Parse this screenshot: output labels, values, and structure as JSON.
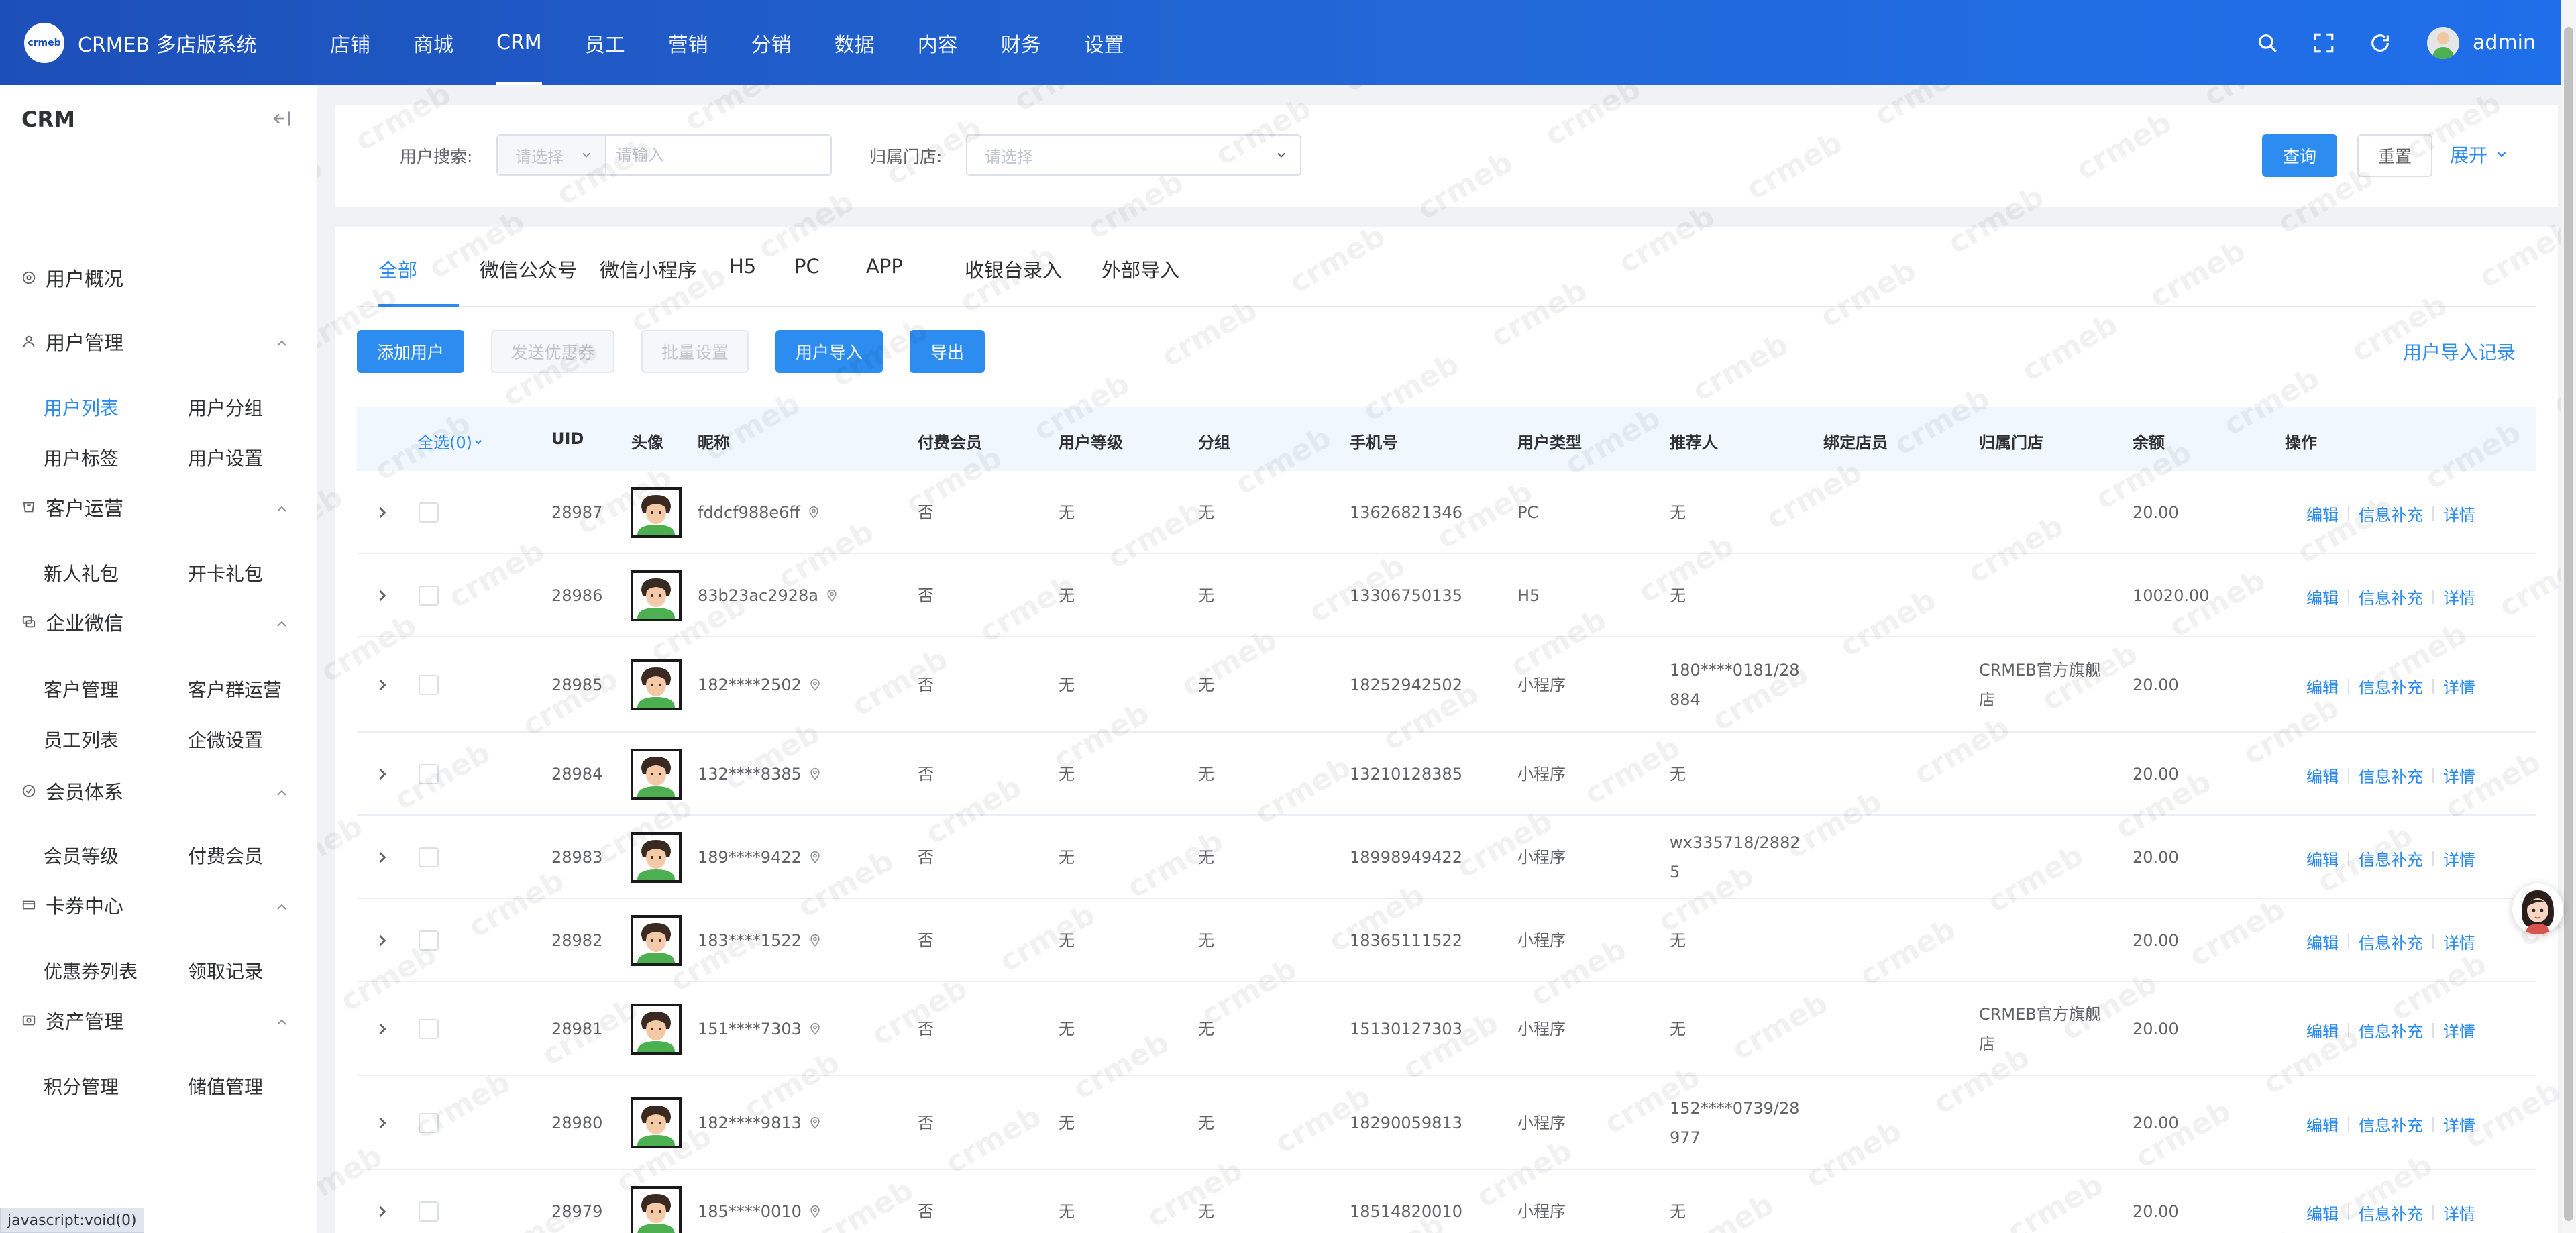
{
  "header": {
    "logo_text": "CRMEB 多店版系统",
    "logo_mark": "crmeb",
    "nav": [
      "店铺",
      "商城",
      "CRM",
      "员工",
      "营销",
      "分销",
      "数据",
      "内容",
      "财务",
      "设置"
    ],
    "active_nav": "CRM",
    "user_name": "admin",
    "icons": [
      "search-icon",
      "fullscreen-icon",
      "refresh-icon"
    ]
  },
  "sidebar": {
    "title": "CRM",
    "groups": [
      {
        "label": "用户概况",
        "icon": "overview-icon",
        "items": []
      },
      {
        "label": "用户管理",
        "icon": "user-icon",
        "items": [
          "用户列表",
          "用户分组",
          "用户标签",
          "用户设置"
        ]
      },
      {
        "label": "客户运营",
        "icon": "operation-icon",
        "items": [
          "新人礼包",
          "开卡礼包"
        ]
      },
      {
        "label": "企业微信",
        "icon": "wechat-work-icon",
        "items": [
          "客户管理",
          "客户群运营",
          "员工列表",
          "企微设置"
        ]
      },
      {
        "label": "会员体系",
        "icon": "member-icon",
        "items": [
          "会员等级",
          "付费会员"
        ]
      },
      {
        "label": "卡券中心",
        "icon": "coupon-icon",
        "items": [
          "优惠券列表",
          "领取记录"
        ]
      },
      {
        "label": "资产管理",
        "icon": "asset-icon",
        "items": [
          "积分管理",
          "储值管理"
        ]
      }
    ],
    "active_item": "用户列表"
  },
  "search": {
    "user_search_label": "用户搜索:",
    "user_search_select": "请选择",
    "user_search_placeholder": "请输入",
    "store_label": "归属门店:",
    "store_placeholder": "请选择",
    "query_button": "查询",
    "reset_button": "重置",
    "expand_link": "展开"
  },
  "tabs": [
    "全部",
    "微信公众号",
    "微信小程序",
    "H5",
    "PC",
    "APP",
    "收银台录入",
    "外部导入"
  ],
  "active_tab": "全部",
  "actions": {
    "add_user": "添加用户",
    "send_coupon": "发送优惠券",
    "batch_settings": "批量设置",
    "import_users": "用户导入",
    "export": "导出",
    "import_records": "用户导入记录"
  },
  "table": {
    "select_all": "全选(0)",
    "columns": [
      "UID",
      "头像",
      "昵称",
      "付费会员",
      "用户等级",
      "分组",
      "手机号",
      "用户类型",
      "推荐人",
      "绑定店员",
      "归属门店",
      "余额",
      "操作"
    ],
    "rows": [
      {
        "uid": "28987",
        "nick": "fddcf988e6ff",
        "paid": "否",
        "level": "无",
        "group": "无",
        "phone": "13626821346",
        "type": "PC",
        "referrer": "无",
        "store": "",
        "balance": "20.00"
      },
      {
        "uid": "28986",
        "nick": "83b23ac2928a",
        "paid": "否",
        "level": "无",
        "group": "无",
        "phone": "13306750135",
        "type": "H5",
        "referrer": "无",
        "store": "",
        "balance": "10020.00"
      },
      {
        "uid": "28985",
        "nick": "182****2502",
        "paid": "否",
        "level": "无",
        "group": "无",
        "phone": "18252942502",
        "type": "小程序",
        "referrer": "180****0181/28884",
        "store": "CRMEB官方旗舰店",
        "balance": "20.00"
      },
      {
        "uid": "28984",
        "nick": "132****8385",
        "paid": "否",
        "level": "无",
        "group": "无",
        "phone": "13210128385",
        "type": "小程序",
        "referrer": "无",
        "store": "",
        "balance": "20.00"
      },
      {
        "uid": "28983",
        "nick": "189****9422",
        "paid": "否",
        "level": "无",
        "group": "无",
        "phone": "18998949422",
        "type": "小程序",
        "referrer": "wx335718/28825",
        "store": "",
        "balance": "20.00"
      },
      {
        "uid": "28982",
        "nick": "183****1522",
        "paid": "否",
        "level": "无",
        "group": "无",
        "phone": "18365111522",
        "type": "小程序",
        "referrer": "无",
        "store": "",
        "balance": "20.00"
      },
      {
        "uid": "28981",
        "nick": "151****7303",
        "paid": "否",
        "level": "无",
        "group": "无",
        "phone": "15130127303",
        "type": "小程序",
        "referrer": "无",
        "store": "CRMEB官方旗舰店",
        "balance": "20.00"
      },
      {
        "uid": "28980",
        "nick": "182****9813",
        "paid": "否",
        "level": "无",
        "group": "无",
        "phone": "18290059813",
        "type": "小程序",
        "referrer": "152****0739/28977",
        "store": "",
        "balance": "20.00"
      },
      {
        "uid": "28979",
        "nick": "185****0010",
        "paid": "否",
        "level": "无",
        "group": "无",
        "phone": "18514820010",
        "type": "小程序",
        "referrer": "无",
        "store": "",
        "balance": "20.00"
      }
    ],
    "ops": [
      "编辑",
      "信息补充",
      "详情"
    ]
  },
  "status_bar": "javascript:void(0)",
  "colors": {
    "primary": "#2d8cf0",
    "header_start": "#1d4fb8",
    "header_end": "#1f6fea",
    "table_header_bg": "#f0f7ff"
  }
}
